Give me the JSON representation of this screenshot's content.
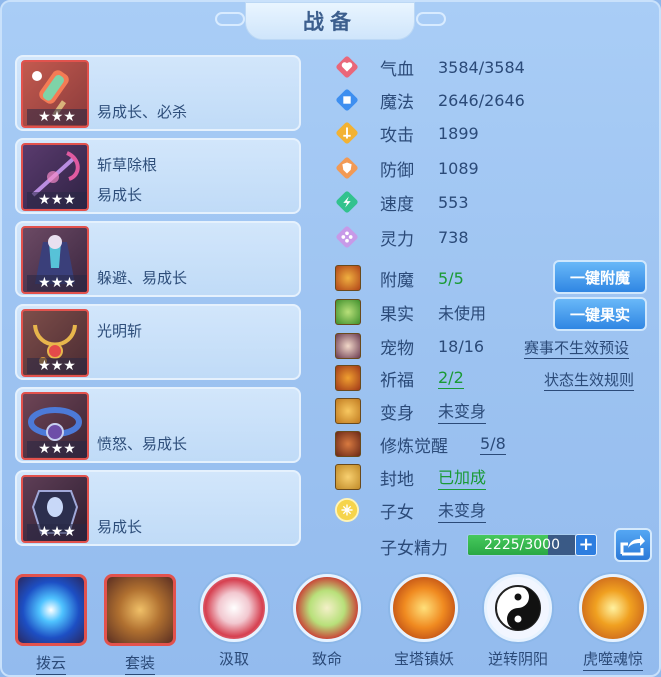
{
  "title": "战备",
  "equipment": [
    {
      "line1": "",
      "line2": "易成长、必杀",
      "stars": "★★★",
      "icon": "popsicle-icon"
    },
    {
      "line1": "斩草除根",
      "line2": "易成长",
      "stars": "★★★",
      "icon": "scythe-icon"
    },
    {
      "line1": "",
      "line2": "躲避、易成长",
      "stars": "★★★",
      "icon": "robe-icon"
    },
    {
      "line1": "光明斩",
      "line2": "",
      "stars": "★★★",
      "icon": "necklace-icon"
    },
    {
      "line1": "",
      "line2": "愤怒、易成长",
      "stars": "★★★",
      "icon": "belt-icon"
    },
    {
      "line1": "",
      "line2": "易成长",
      "stars": "★★★",
      "icon": "armor-icon"
    }
  ],
  "stats": [
    {
      "label": "气血",
      "value": "3584/3584",
      "icon": "heart-icon",
      "color": "#e9677a"
    },
    {
      "label": "魔法",
      "value": "2646/2646",
      "icon": "mana-icon",
      "color": "#3e8ff0"
    },
    {
      "label": "攻击",
      "value": "1899",
      "icon": "sword-icon",
      "color": "#f2b233"
    },
    {
      "label": "防御",
      "value": "1089",
      "icon": "shield-icon",
      "color": "#f29a55"
    },
    {
      "label": "速度",
      "value": "553",
      "icon": "speed-icon",
      "color": "#32c28e"
    },
    {
      "label": "灵力",
      "value": "738",
      "icon": "spirit-icon",
      "color": "#c79ae8"
    }
  ],
  "attributes": {
    "enchant": {
      "label": "附魔",
      "value": "5/5",
      "icon": "enchant-icon"
    },
    "fruit": {
      "label": "果实",
      "value": "未使用",
      "icon": "fruit-icon"
    },
    "pet": {
      "label": "宠物",
      "value": "18/16",
      "icon": "pet-icon"
    },
    "blessing": {
      "label": "祈福",
      "value": "2/2",
      "icon": "blessing-icon"
    },
    "transform": {
      "label": "变身",
      "value": "未变身",
      "icon": "transform-icon"
    },
    "awaken": {
      "label": "修炼觉醒",
      "value": "5/8",
      "icon": "awaken-icon"
    },
    "seal": {
      "label": "封地",
      "value": "已加成",
      "icon": "seal-icon"
    },
    "child": {
      "label": "子女",
      "value": "未变身",
      "icon": "child-icon"
    },
    "child_energy": {
      "label": "子女精力",
      "value": "2225/3000",
      "fraction": 0.7417
    }
  },
  "buttons": {
    "one_click_enchant": "一键附魔",
    "one_click_fruit": "一键果实",
    "event_preset": "赛事不生效预设",
    "status_rules": "状态生效规则"
  },
  "skills": [
    {
      "label": "拨云",
      "icon": "cloud-orb-icon",
      "shape": "square",
      "underline": true
    },
    {
      "label": "套装",
      "icon": "bronze-vessel-icon",
      "shape": "square",
      "underline": true
    },
    {
      "label": "汲取",
      "icon": "red-swirl-icon",
      "shape": "circle",
      "underline": false
    },
    {
      "label": "致命",
      "icon": "vine-icon",
      "shape": "circle",
      "underline": false
    },
    {
      "label": "宝塔镇妖",
      "icon": "pagoda-icon",
      "shape": "circle",
      "underline": false
    },
    {
      "label": "逆转阴阳",
      "icon": "yinyang-icon",
      "shape": "circle",
      "underline": false
    },
    {
      "label": "虎噬魂惊",
      "icon": "tiger-icon",
      "shape": "circle",
      "underline": true
    }
  ]
}
